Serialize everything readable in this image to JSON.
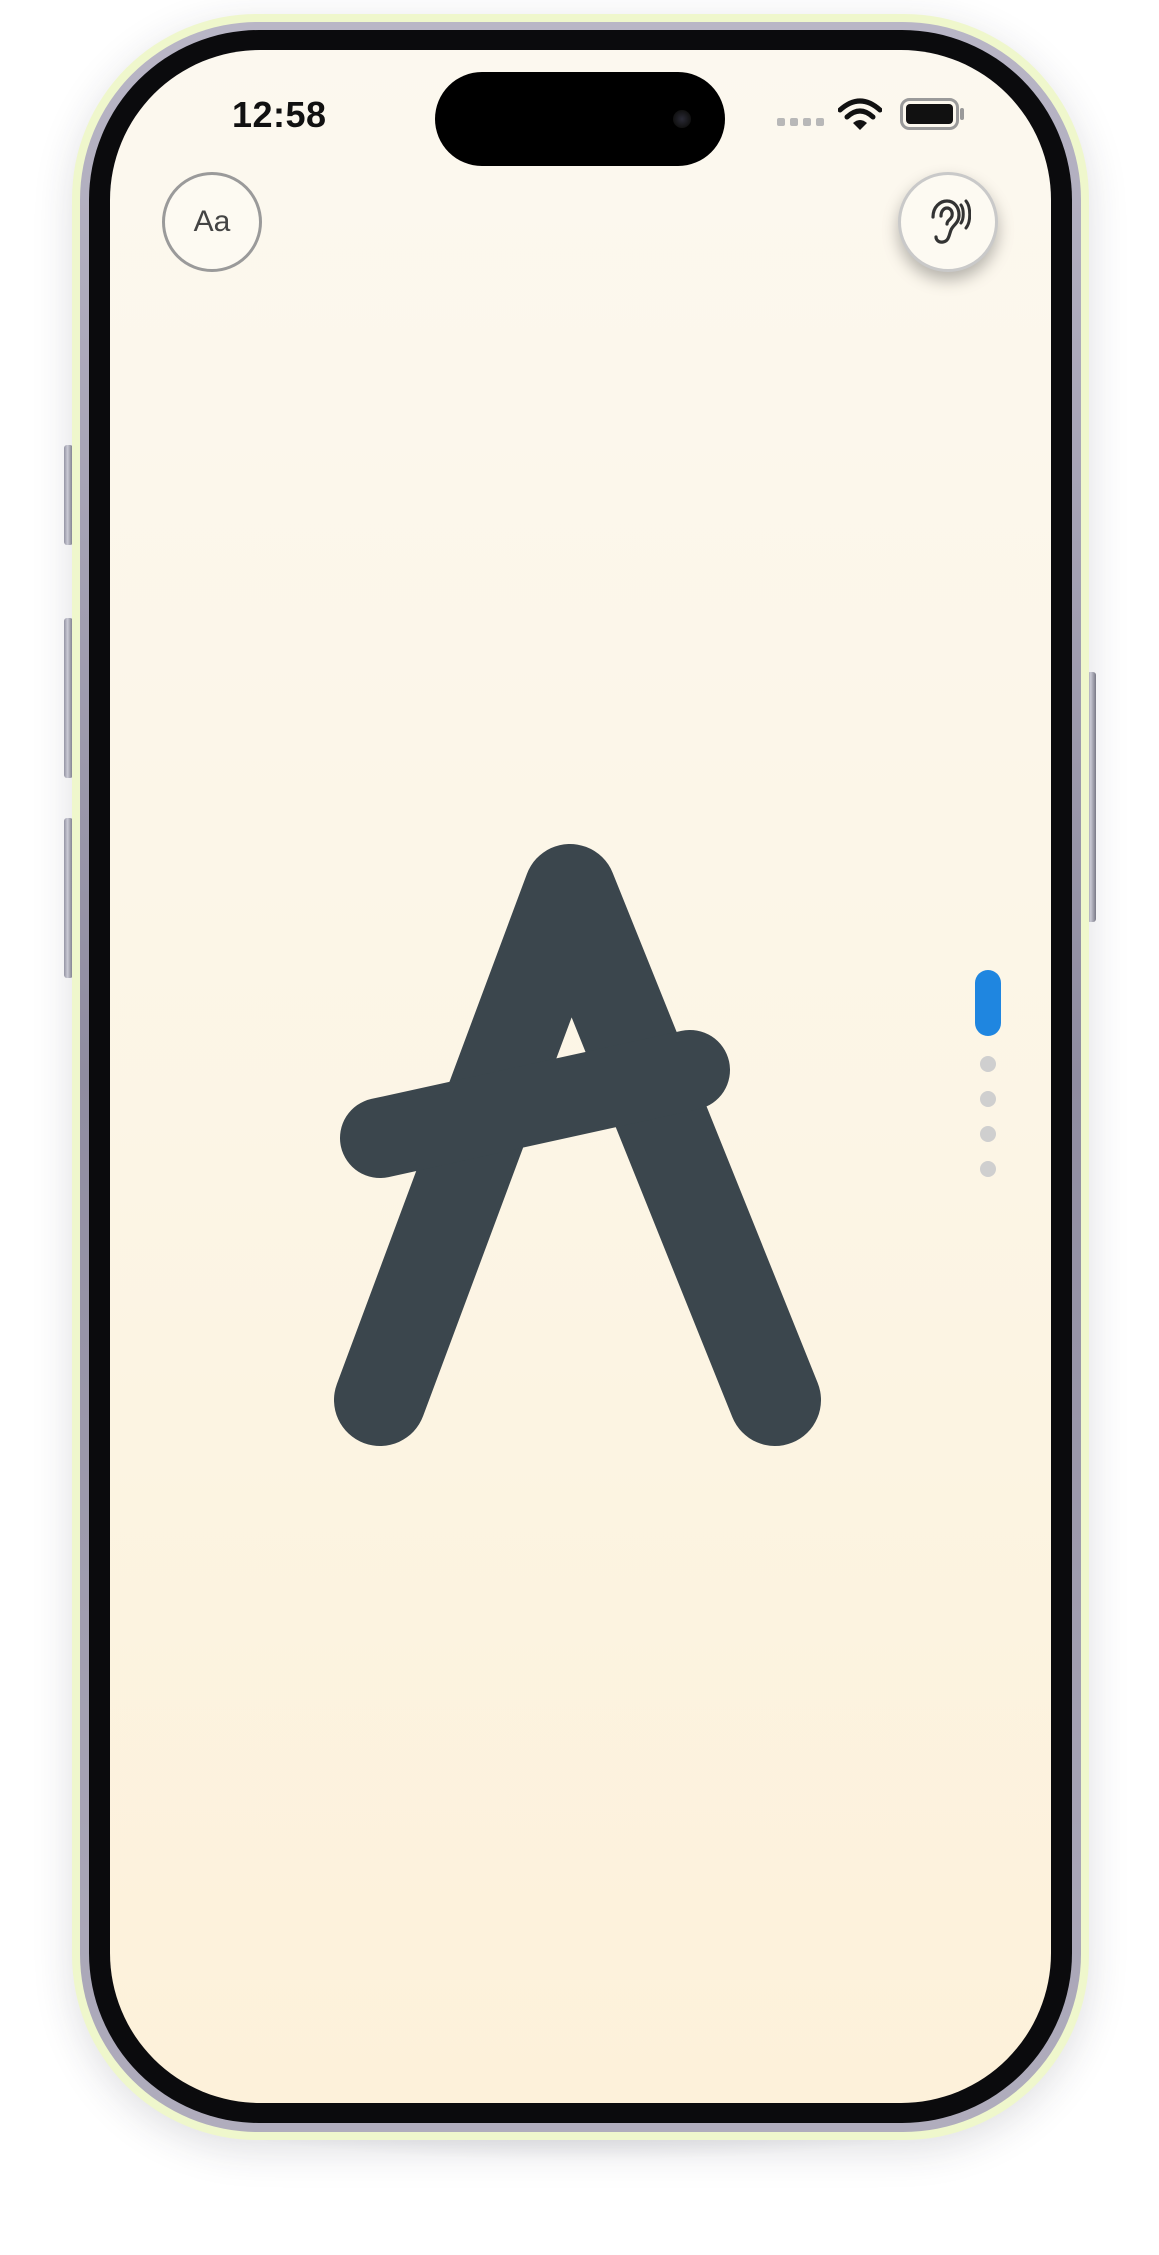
{
  "status_bar": {
    "time": "12:58",
    "icons": [
      "signal-icon",
      "wifi-icon",
      "battery-icon"
    ]
  },
  "toolbar": {
    "font_button_label": "Aa",
    "listen_button_icon": "ear-sound-icon"
  },
  "flashcard": {
    "letter": "A",
    "letter_color": "#3b464d"
  },
  "pager": {
    "total_pages": 5,
    "current_page": 1,
    "active_color": "#1f86e0",
    "inactive_color": "#cfcfcf"
  },
  "theme": {
    "background_top": "#fcf8ef",
    "background_bottom": "#fdf1da"
  }
}
